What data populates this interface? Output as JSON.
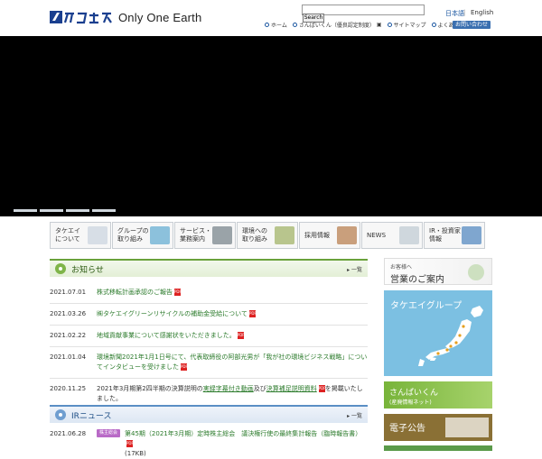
{
  "header": {
    "tagline": "Only One Earth",
    "search_button": "Search",
    "lang_ja": "日本語",
    "lang_sep": "|",
    "lang_en": "English",
    "nav": [
      "ホーム",
      "さんぱいくん（優良認定制度）",
      "サイトマップ",
      "よくある質問"
    ],
    "contact": "お問い合わせ"
  },
  "categories": [
    {
      "label": "タケエイ\nについて",
      "thumb": "#d7dee6"
    },
    {
      "label": "グループの\n取り組み",
      "thumb": "#8cc1dc"
    },
    {
      "label": "サービス・\n業務案内",
      "thumb": "#9aa3a8"
    },
    {
      "label": "環境への\n取り組み",
      "thumb": "#b8c58d"
    },
    {
      "label": "採用情報",
      "thumb": "#c99f7c"
    },
    {
      "label": "NEWS",
      "thumb": "#cfd7dd"
    },
    {
      "label": "IR・投資家\n情報",
      "thumb": "#7fa6cf"
    }
  ],
  "news": {
    "title": "お知らせ",
    "more": "一覧",
    "items": [
      {
        "date": "2021.07.01",
        "text": "株式移転計画承認のご報告",
        "style": "link"
      },
      {
        "date": "2021.03.26",
        "text": "㈱タケエイグリーンリサイクルの補助金受給について",
        "style": "link"
      },
      {
        "date": "2021.02.22",
        "text": "地域貢献事業について感謝状をいただきました。",
        "style": "link"
      },
      {
        "date": "2021.01.04",
        "text": "環境新聞2021年1月1日号にて、代表取締役の阿部光男が「我が社の環境ビジネス戦略」についてインタビューを受けました",
        "style": "link"
      },
      {
        "date": "2020.11.25",
        "pre": "2021年3月期第2四半期の決算説明の",
        "link1": "実録字幕付き動画",
        "mid": "及び",
        "link2": "決算補足説明資料",
        "post": "を掲載いたしました。",
        "style": "mixed"
      }
    ]
  },
  "ir": {
    "title": "IRニュース",
    "more": "一覧",
    "items": [
      {
        "date": "2021.06.28",
        "badge": "株主総会",
        "text": "第45期（2021年3月期）定時株主総会　議決権行使の最終集計報告（臨時報告書）",
        "size": "(17KB)"
      }
    ]
  },
  "banners": {
    "sales_small": "お客様へ",
    "sales_big": "営業のご案内",
    "group": "タケエイグループ",
    "sanpai_title": "さんぱいくん",
    "sanpai_sub": "(産廃情報ネット)",
    "koukoku": "電子公告"
  }
}
